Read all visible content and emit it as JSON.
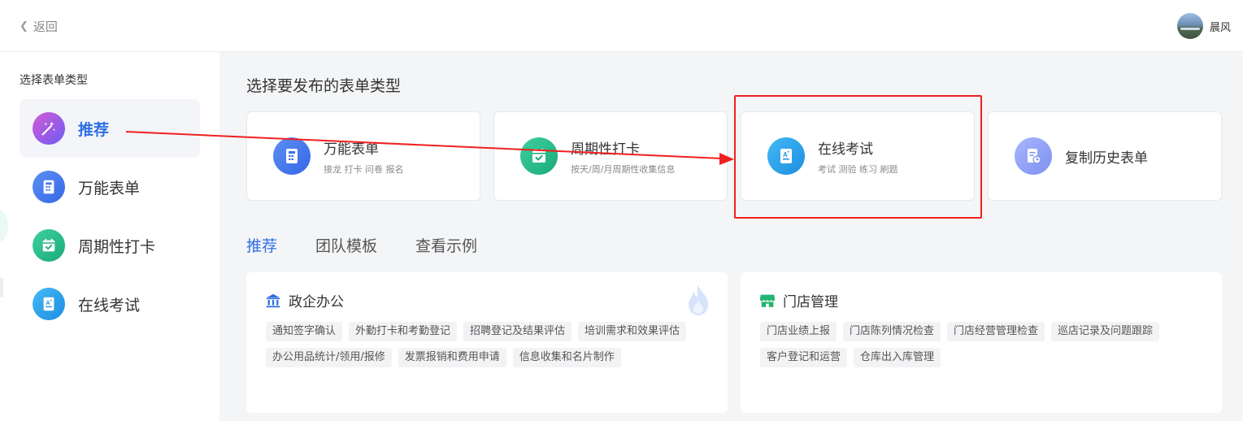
{
  "header": {
    "back_label": "返回",
    "user_name": "晨风"
  },
  "sidebar": {
    "title": "选择表单类型",
    "items": [
      {
        "label": "推荐",
        "icon": "magic-wand-icon",
        "active": true
      },
      {
        "label": "万能表单",
        "icon": "form-icon"
      },
      {
        "label": "周期性打卡",
        "icon": "calendar-check-icon"
      },
      {
        "label": "在线考试",
        "icon": "exam-icon"
      }
    ]
  },
  "main": {
    "title": "选择要发布的表单类型",
    "type_cards": [
      {
        "name": "万能表单",
        "desc": "接龙 打卡 问卷 报名",
        "icon": "form-icon"
      },
      {
        "name": "周期性打卡",
        "desc": "按天/周/月周期性收集信息",
        "icon": "calendar-check-icon"
      },
      {
        "name": "在线考试",
        "desc": "考试 测验 练习 刷题",
        "icon": "exam-icon",
        "highlighted": true
      },
      {
        "name": "复制历史表单",
        "desc": "",
        "icon": "history-form-icon"
      }
    ],
    "tabs": [
      {
        "label": "推荐",
        "active": true
      },
      {
        "label": "团队模板"
      },
      {
        "label": "查看示例"
      }
    ],
    "categories": [
      {
        "name": "政企办公",
        "icon": "government-building-icon",
        "hot": true,
        "tags": [
          "通知签字确认",
          "外勤打卡和考勤登记",
          "招聘登记及结果评估",
          "培训需求和效果评估",
          "办公用品统计/领用/报修",
          "发票报销和费用申请",
          "信息收集和名片制作"
        ]
      },
      {
        "name": "门店管理",
        "icon": "store-icon",
        "tags": [
          "门店业绩上报",
          "门店陈列情况检查",
          "门店经营管理检查",
          "巡店记录及问题跟踪",
          "客户登记和运营",
          "仓库出入库管理"
        ]
      }
    ]
  },
  "colors": {
    "accent": "#2f6fe6",
    "annotation": "#f02020",
    "main_bg": "#f4f5f7"
  }
}
